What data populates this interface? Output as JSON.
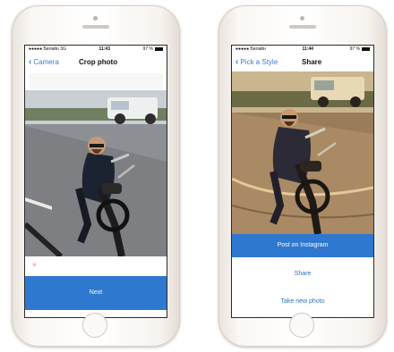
{
  "left_phone": {
    "status": {
      "carrier": "●●●●● Билайн  3G",
      "time": "11:43",
      "battery": "97 %"
    },
    "nav": {
      "back_label": "Camera",
      "title": "Crop photo"
    },
    "next_label": "Next"
  },
  "right_phone": {
    "status": {
      "carrier": "●●●●● Билайн",
      "time": "11:44",
      "battery": "97 %"
    },
    "nav": {
      "back_label": "Pick a Style",
      "title": "Share"
    },
    "actions": {
      "post_label": "Post on Instagram",
      "share_label": "Share",
      "take_new_label": "Take new photo"
    }
  },
  "colors": {
    "accent": "#2f78cf",
    "link": "#3a7bd5"
  },
  "icons": {
    "back": "chevron-left-icon",
    "battery": "battery-icon",
    "like": "heart-icon"
  }
}
